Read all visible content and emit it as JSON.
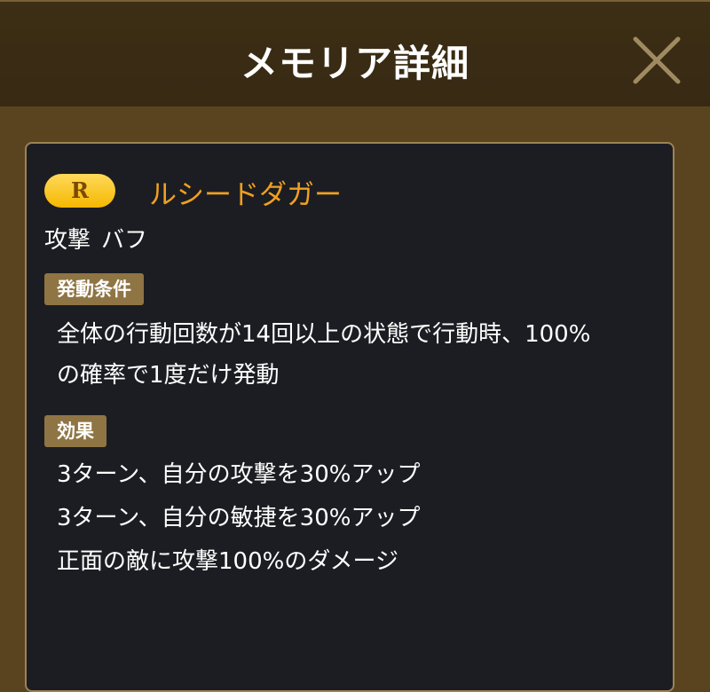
{
  "header": {
    "title": "メモリア詳細",
    "close_icon": "close-icon"
  },
  "memoria": {
    "rarity": "R",
    "name": "ルシードダガー",
    "tags": [
      "攻撃",
      "バフ"
    ]
  },
  "condition": {
    "label": "発動条件",
    "lines": [
      "全体の行動回数が14回以上の状態で行動時、100%",
      "の確率で1度だけ発動"
    ]
  },
  "effect": {
    "label": "効果",
    "lines": [
      "3ターン、自分の攻撃を30%アップ",
      "3ターン、自分の敏捷を30%アップ",
      "正面の敵に攻撃100%のダメージ"
    ]
  },
  "colors": {
    "header_bg": "#3d2f15",
    "panel_bg": "#5a4420",
    "card_bg": "#1c1d22",
    "card_border": "#9b8354",
    "name_color": "#f0a020",
    "badge_gold": "#f5b800",
    "label_bg": "#8f7444"
  }
}
